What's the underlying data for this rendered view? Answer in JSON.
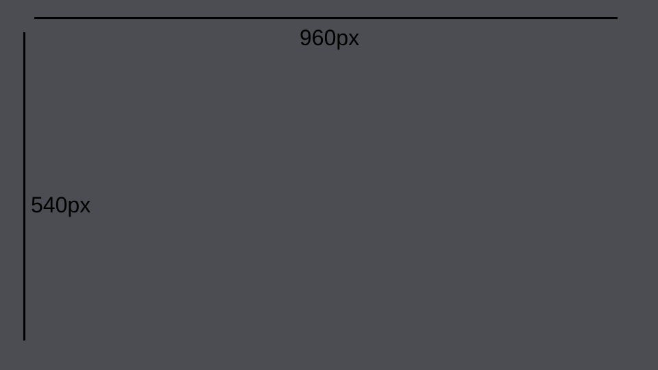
{
  "colors": {
    "background": "#4c4d52",
    "rule": "#000000",
    "label": "#000000"
  },
  "width_label": "960px",
  "height_label": "540px"
}
